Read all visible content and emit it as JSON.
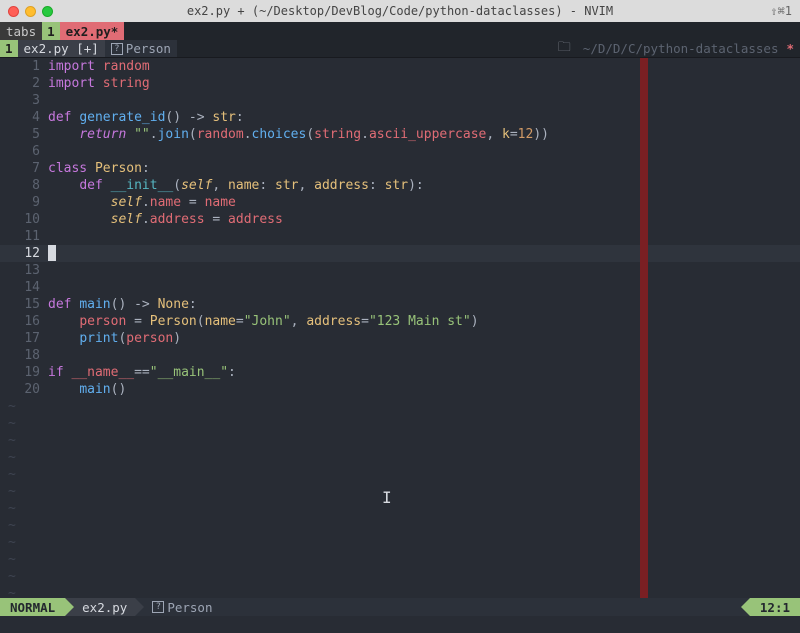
{
  "titlebar": {
    "center": "ex2.py + (~/Desktop/DevBlog/Code/python-dataclasses) - NVIM",
    "right": "⇧⌘1"
  },
  "tabline": {
    "tabs_label": "tabs",
    "tab_number": "1",
    "tab_file": "ex2.py",
    "tab_star": "*"
  },
  "winbar": {
    "win_number": "1",
    "win_file": "ex2.py  [+]",
    "crumb": "Person",
    "path": "~/D/D/C/python-dataclasses",
    "star": "*"
  },
  "code": {
    "lines": [
      {
        "n": "1",
        "tokens": [
          [
            "kw",
            "import "
          ],
          [
            "id",
            "random"
          ]
        ]
      },
      {
        "n": "2",
        "tokens": [
          [
            "kw",
            "import "
          ],
          [
            "id",
            "string"
          ]
        ]
      },
      {
        "n": "3",
        "tokens": []
      },
      {
        "n": "4",
        "tokens": [
          [
            "kw",
            "def "
          ],
          [
            "fn",
            "generate_id"
          ],
          [
            "op",
            "() -> "
          ],
          [
            "type",
            "str"
          ],
          [
            "op",
            ":"
          ]
        ]
      },
      {
        "n": "5",
        "tokens": [
          [
            "op",
            "    "
          ],
          [
            "kw2",
            "return "
          ],
          [
            "str",
            "\"\""
          ],
          [
            "op",
            "."
          ],
          [
            "fn",
            "join"
          ],
          [
            "op",
            "("
          ],
          [
            "id",
            "random"
          ],
          [
            "op",
            "."
          ],
          [
            "fn",
            "choices"
          ],
          [
            "op",
            "("
          ],
          [
            "id",
            "string"
          ],
          [
            "op",
            "."
          ],
          [
            "id",
            "ascii_uppercase"
          ],
          [
            "op",
            ", "
          ],
          [
            "prm",
            "k"
          ],
          [
            "op",
            "="
          ],
          [
            "num",
            "12"
          ],
          [
            "op",
            "))"
          ]
        ]
      },
      {
        "n": "6",
        "tokens": []
      },
      {
        "n": "7",
        "tokens": [
          [
            "kw",
            "class "
          ],
          [
            "type",
            "Person"
          ],
          [
            "op",
            ":"
          ]
        ]
      },
      {
        "n": "8",
        "tokens": [
          [
            "op",
            "    "
          ],
          [
            "kw",
            "def "
          ],
          [
            "dunder",
            "__init__"
          ],
          [
            "op",
            "("
          ],
          [
            "self",
            "self"
          ],
          [
            "op",
            ", "
          ],
          [
            "prm",
            "name"
          ],
          [
            "op",
            ": "
          ],
          [
            "type",
            "str"
          ],
          [
            "op",
            ", "
          ],
          [
            "prm",
            "address"
          ],
          [
            "op",
            ": "
          ],
          [
            "type",
            "str"
          ],
          [
            "op",
            "):"
          ]
        ]
      },
      {
        "n": "9",
        "tokens": [
          [
            "op",
            "        "
          ],
          [
            "self",
            "self"
          ],
          [
            "op",
            "."
          ],
          [
            "id",
            "name"
          ],
          [
            "op",
            " = "
          ],
          [
            "id",
            "name"
          ]
        ]
      },
      {
        "n": "10",
        "tokens": [
          [
            "op",
            "        "
          ],
          [
            "self",
            "self"
          ],
          [
            "op",
            "."
          ],
          [
            "id",
            "address"
          ],
          [
            "op",
            " = "
          ],
          [
            "id",
            "address"
          ]
        ]
      },
      {
        "n": "11",
        "tokens": []
      },
      {
        "n": "12",
        "tokens": [],
        "cursor": true
      },
      {
        "n": "13",
        "tokens": []
      },
      {
        "n": "14",
        "tokens": []
      },
      {
        "n": "15",
        "tokens": [
          [
            "kw",
            "def "
          ],
          [
            "fn",
            "main"
          ],
          [
            "op",
            "() -> "
          ],
          [
            "type",
            "None"
          ],
          [
            "op",
            ":"
          ]
        ]
      },
      {
        "n": "16",
        "tokens": [
          [
            "op",
            "    "
          ],
          [
            "id",
            "person"
          ],
          [
            "op",
            " = "
          ],
          [
            "type",
            "Person"
          ],
          [
            "op",
            "("
          ],
          [
            "prm",
            "name"
          ],
          [
            "op",
            "="
          ],
          [
            "str",
            "\"John\""
          ],
          [
            "op",
            ", "
          ],
          [
            "prm",
            "address"
          ],
          [
            "op",
            "="
          ],
          [
            "str",
            "\"123 Main st\""
          ],
          [
            "op",
            ")"
          ]
        ]
      },
      {
        "n": "17",
        "tokens": [
          [
            "op",
            "    "
          ],
          [
            "fn",
            "print"
          ],
          [
            "op",
            "("
          ],
          [
            "id",
            "person"
          ],
          [
            "op",
            ")"
          ]
        ]
      },
      {
        "n": "18",
        "tokens": []
      },
      {
        "n": "19",
        "tokens": [
          [
            "kw",
            "if "
          ],
          [
            "id",
            "__name__"
          ],
          [
            "op",
            "=="
          ],
          [
            "str",
            "\"__main__\""
          ],
          [
            "op",
            ":"
          ]
        ]
      },
      {
        "n": "20",
        "tokens": [
          [
            "op",
            "    "
          ],
          [
            "fn",
            "main"
          ],
          [
            "op",
            "()"
          ]
        ]
      }
    ]
  },
  "statusline": {
    "mode": "NORMAL",
    "file": "ex2.py",
    "crumb": "Person",
    "pos": "12:1"
  }
}
